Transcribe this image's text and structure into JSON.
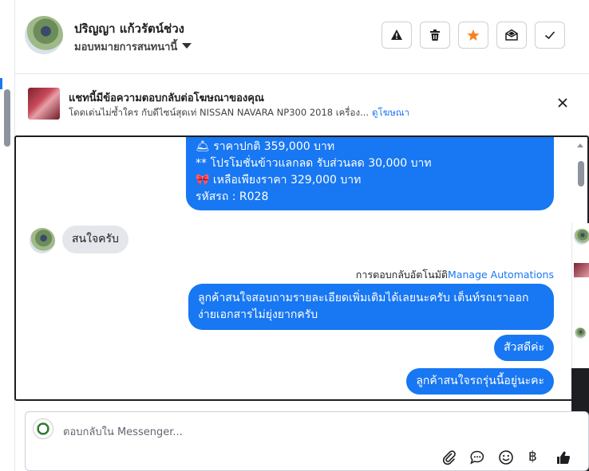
{
  "header": {
    "user_name": "ปริญญา แก้วรัตน์ช่วง",
    "assign_label": "มอบหมายการสนทนานี้",
    "actions": [
      {
        "name": "report-button",
        "icon": "warning-icon"
      },
      {
        "name": "delete-button",
        "icon": "trash-icon"
      },
      {
        "name": "star-button",
        "icon": "star-icon",
        "color": "#f5821f"
      },
      {
        "name": "mark-unread-button",
        "icon": "envelope-open-icon"
      },
      {
        "name": "mark-done-button",
        "icon": "check-icon"
      }
    ]
  },
  "ad_banner": {
    "title": "แชทนี้มีข้อความตอบกลับต่อโฆษณาของคุณ",
    "subtitle": "โดดเด่นไม่ซ้ำใคร กับดีไซน์สุดเท่ NISSAN NAVARA NP300 2018 เครื่อง...",
    "link": "ดูโฆษณา"
  },
  "messages": {
    "promo_lines": [
      "🛎 ราคาปกติ 359,000 บาท",
      "** โปรโมชั่นข้าวแลกลด รับส่วนลด 30,000 บาท",
      "🎀  เหลือเพียงราคา 329,000 บาท",
      " รหัสรถ : R028"
    ],
    "incoming_1": "สนใจครับ",
    "auto_reply_label": "การตอบกลับอัตโนมัติ",
    "auto_reply_link": "Manage Automations",
    "outgoing_1": "ลูกค้าสนใจสอบถามรายละเอียดเพิ่มเติมได้เลยนะครับ เต็นท์รถเราออกง่ายเอกสารไม่ยุ่งยากครับ",
    "outgoing_2": "สัวสดีค่ะ",
    "outgoing_3": "ลูกค้าสนใจรถรุ่นนี้อยู่นะคะ"
  },
  "composer": {
    "placeholder": "ตอบกลับใน Messenger...",
    "icons": [
      "attachment-icon",
      "saved-reply-icon",
      "emoji-icon",
      "payment-baht-icon",
      "thumbs-up-icon"
    ]
  },
  "colors": {
    "accent": "#1877f2",
    "bubble_in": "#e4e6eb",
    "star": "#f5821f"
  }
}
